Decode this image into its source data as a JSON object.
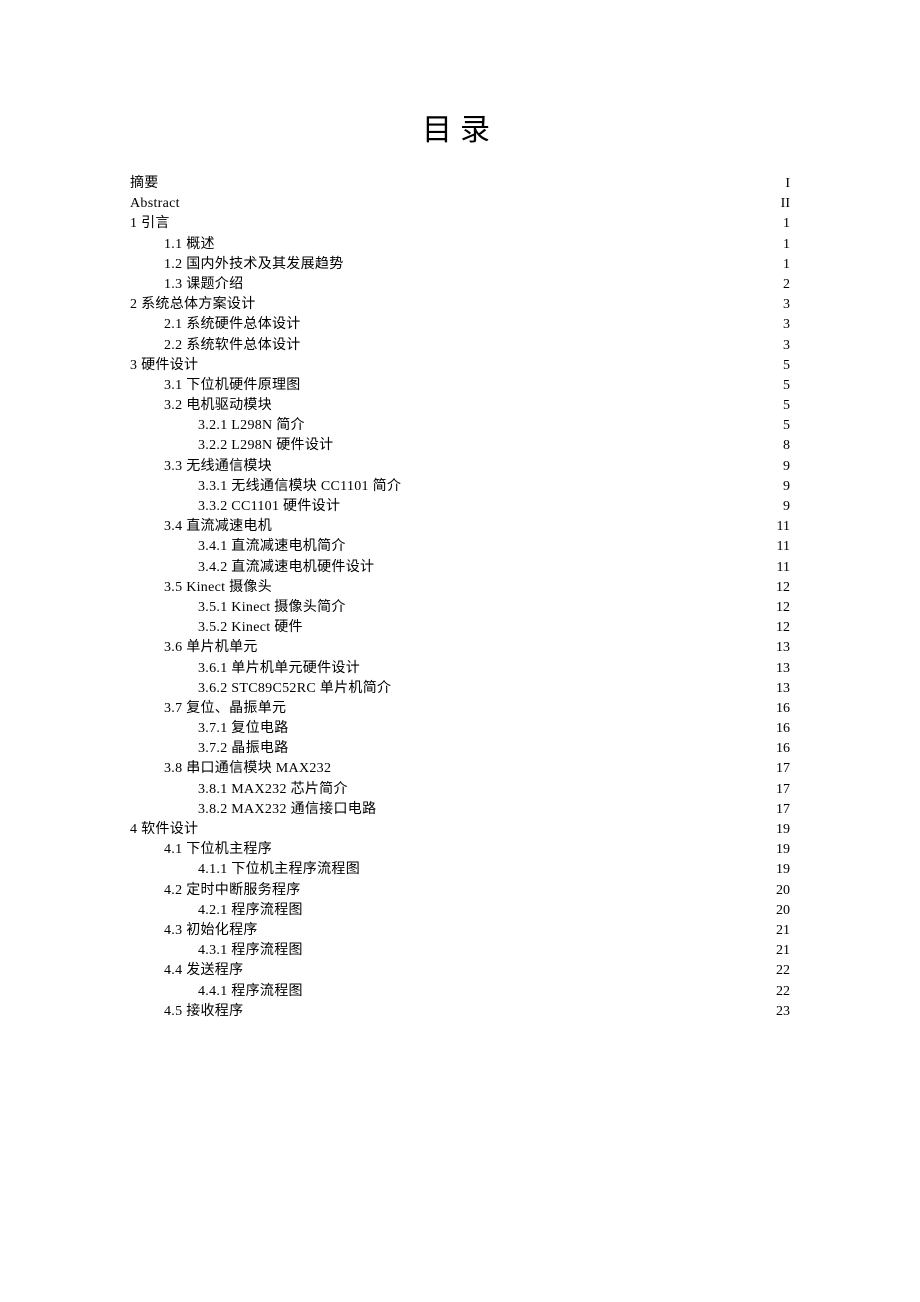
{
  "title": "目录",
  "toc": [
    {
      "level": 0,
      "label": "摘要",
      "page": "I"
    },
    {
      "level": 0,
      "label": "Abstract",
      "page": "II"
    },
    {
      "level": 0,
      "label": "1 引言",
      "page": "1"
    },
    {
      "level": 1,
      "label": "1.1 概述",
      "page": "1"
    },
    {
      "level": 1,
      "label": "1.2 国内外技术及其发展趋势",
      "page": "1"
    },
    {
      "level": 1,
      "label": "1.3 课题介绍",
      "page": "2"
    },
    {
      "level": 0,
      "label": "2 系统总体方案设计",
      "page": "3"
    },
    {
      "level": 1,
      "label": "2.1  系统硬件总体设计",
      "page": "3"
    },
    {
      "level": 1,
      "label": "2.2  系统软件总体设计",
      "page": "3"
    },
    {
      "level": 0,
      "label": "3 硬件设计",
      "page": "5"
    },
    {
      "level": 1,
      "label": "3.1  下位机硬件原理图",
      "page": "5"
    },
    {
      "level": 1,
      "label": "3.2  电机驱动模块",
      "page": "5"
    },
    {
      "level": 2,
      "label": "3.2.1 L298N 简介",
      "page": "5"
    },
    {
      "level": 2,
      "label": "3.2.2 L298N 硬件设计",
      "page": "8"
    },
    {
      "level": 1,
      "label": "3.3  无线通信模块",
      "page": "9"
    },
    {
      "level": 2,
      "label": "3.3.1 无线通信模块 CC1101 简介",
      "page": "9"
    },
    {
      "level": 2,
      "label": "3.3.2 CC1101 硬件设计",
      "page": "9"
    },
    {
      "level": 1,
      "label": "3.4  直流减速电机",
      "page": "11"
    },
    {
      "level": 2,
      "label": "3.4.1  直流减速电机简介",
      "page": "11"
    },
    {
      "level": 2,
      "label": "3.4.2  直流减速电机硬件设计",
      "page": "11"
    },
    {
      "level": 1,
      "label": "3.5 Kinect 摄像头",
      "page": "12"
    },
    {
      "level": 2,
      "label": "3.5.1 Kinect 摄像头简介",
      "page": "12"
    },
    {
      "level": 2,
      "label": "3.5.2 Kinect 硬件",
      "page": "12"
    },
    {
      "level": 1,
      "label": "3.6  单片机单元",
      "page": "13"
    },
    {
      "level": 2,
      "label": "3.6.1  单片机单元硬件设计",
      "page": "13"
    },
    {
      "level": 2,
      "label": "3.6.2 STC89C52RC 单片机简介",
      "page": "13"
    },
    {
      "level": 1,
      "label": "3.7 复位、晶振单元",
      "page": "16"
    },
    {
      "level": 2,
      "label": "3.7.1  复位电路",
      "page": "16"
    },
    {
      "level": 2,
      "label": "3.7.2 晶振电路",
      "page": "16"
    },
    {
      "level": 1,
      "label": "3.8  串口通信模块 MAX232",
      "page": "17"
    },
    {
      "level": 2,
      "label": "3.8.1 MAX232 芯片简介",
      "page": "17"
    },
    {
      "level": 2,
      "label": "3.8.2 MAX232 通信接口电路",
      "page": "17"
    },
    {
      "level": 0,
      "label": "4 软件设计",
      "page": "19"
    },
    {
      "level": 1,
      "label": "4.1  下位机主程序",
      "page": "19"
    },
    {
      "level": 2,
      "label": "4.1.1  下位机主程序流程图",
      "page": "19"
    },
    {
      "level": 1,
      "label": "4.2  定时中断服务程序",
      "page": "20"
    },
    {
      "level": 2,
      "label": "4.2.1  程序流程图",
      "page": "20"
    },
    {
      "level": 1,
      "label": "4.3  初始化程序",
      "page": "21"
    },
    {
      "level": 2,
      "label": "4.3.1  程序流程图",
      "page": "21"
    },
    {
      "level": 1,
      "label": "4.4  发送程序",
      "page": "22"
    },
    {
      "level": 2,
      "label": "4.4.1  程序流程图",
      "page": "22"
    },
    {
      "level": 1,
      "label": "4.5  接收程序",
      "page": "23"
    }
  ]
}
